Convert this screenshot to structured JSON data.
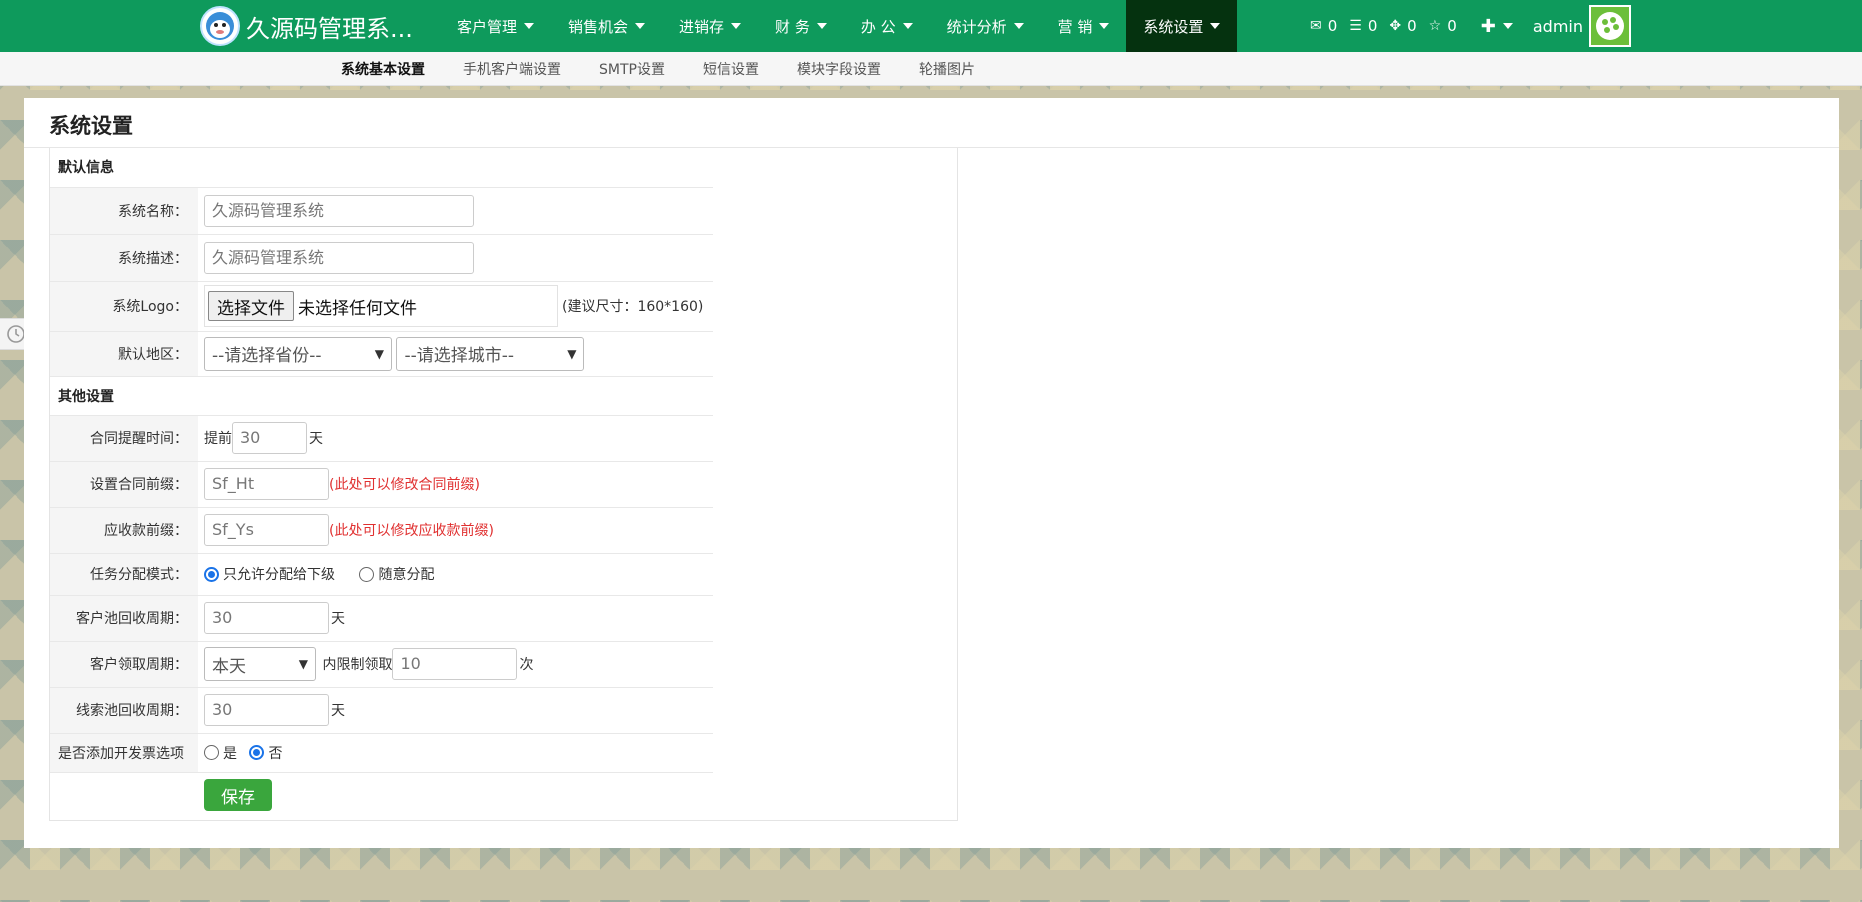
{
  "brand": {
    "title": "久源码管理系..."
  },
  "nav": {
    "items": [
      {
        "label": "客户管理"
      },
      {
        "label": "销售机会"
      },
      {
        "label": "进销存"
      },
      {
        "label": "财 务"
      },
      {
        "label": "办 公"
      },
      {
        "label": "统计分析"
      },
      {
        "label": "营 销"
      },
      {
        "label": "系统设置",
        "active": true
      }
    ],
    "stats": [
      {
        "icon": "envelope-icon",
        "value": "0"
      },
      {
        "icon": "tasks-icon",
        "value": "0"
      },
      {
        "icon": "crosshair-icon",
        "value": "0"
      },
      {
        "icon": "star-icon",
        "value": "0"
      }
    ],
    "user": "admin",
    "accent": "#0e9a5c"
  },
  "subnav": {
    "items": [
      {
        "label": "系统基本设置",
        "active": true
      },
      {
        "label": "手机客户端设置"
      },
      {
        "label": "SMTP设置"
      },
      {
        "label": "短信设置"
      },
      {
        "label": "模块字段设置"
      },
      {
        "label": "轮播图片"
      }
    ]
  },
  "page": {
    "title": "系统设置"
  },
  "form": {
    "section_default": "默认信息",
    "system_name": {
      "label": "系统名称：",
      "placeholder": "久源码管理系统"
    },
    "system_desc": {
      "label": "系统描述：",
      "placeholder": "久源码管理系统"
    },
    "system_logo": {
      "label": "系统Logo：",
      "button": "选择文件",
      "status": "未选择任何文件",
      "hint": "(建议尺寸：160*160)"
    },
    "region": {
      "label": "默认地区：",
      "province": "--请选择省份--",
      "city": "--请选择城市--"
    },
    "section_other": "其他设置",
    "contract_remind": {
      "label": "合同提醒时间：",
      "prefix": "提前",
      "value": "30",
      "unit": "天"
    },
    "contract_prefix": {
      "label": "设置合同前缀：",
      "value": "Sf_Ht",
      "note": "(此处可以修改合同前缀)"
    },
    "receivable_prefix": {
      "label": "应收款前缀：",
      "value": "Sf_Ys",
      "note": "(此处可以修改应收款前缀)"
    },
    "task_mode": {
      "label": "任务分配模式：",
      "option1": "只允许分配给下级",
      "option2": "随意分配"
    },
    "pool_cycle": {
      "label": "客户池回收周期：",
      "value": "30",
      "unit": "天"
    },
    "claim_cycle": {
      "label": "客户领取周期：",
      "select": "本天",
      "middle": "内限制领取",
      "value": "10",
      "unit": "次"
    },
    "lead_cycle": {
      "label": "线索池回收周期：",
      "value": "30",
      "unit": "天"
    },
    "invoice": {
      "label": "是否添加开发票选项",
      "yes": "是",
      "no": "否"
    },
    "save": "保存"
  }
}
